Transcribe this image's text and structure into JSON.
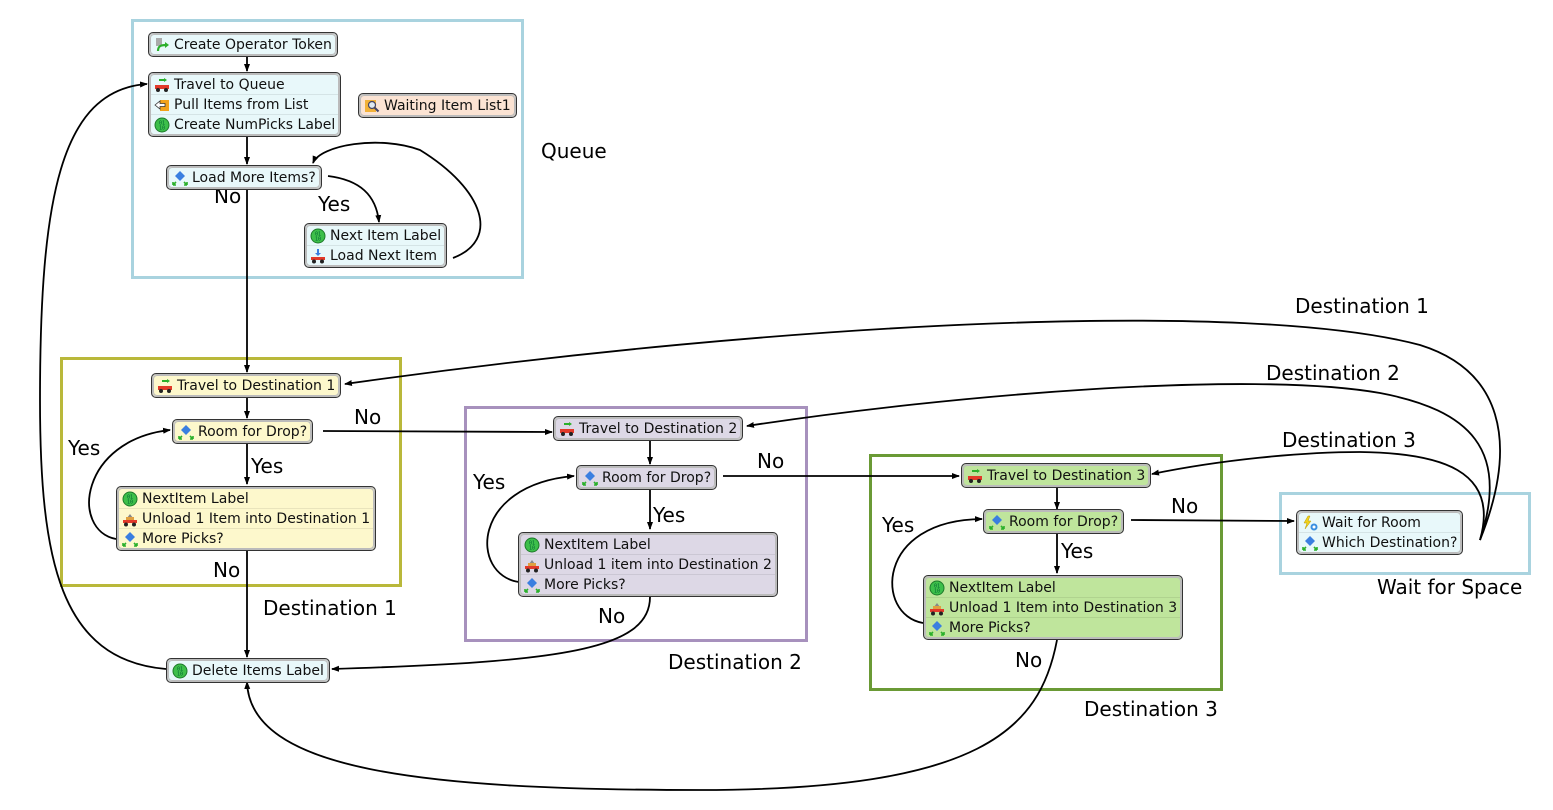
{
  "colors": {
    "queue_border": "#a9d3df",
    "dest1_border": "#b9b83a",
    "dest2_border": "#a791bd",
    "dest3_border": "#6a9a35",
    "wait_border": "#a9d3df",
    "node_blue": "#e8f8fa",
    "node_yellow": "#fdf8cc",
    "node_purple": "#ddd8e6",
    "node_green": "#bfe59c",
    "node_orange": "#fbe3d3"
  },
  "groups": {
    "queue": {
      "label": "Queue"
    },
    "dest1": {
      "label": "Destination 1"
    },
    "dest2": {
      "label": "Destination 2"
    },
    "dest3": {
      "label": "Destination 3"
    },
    "wait": {
      "label": "Wait for Space"
    }
  },
  "nodes": {
    "create_token": {
      "rows": [
        {
          "icon": "create-token-icon",
          "label": "Create Operator Token"
        }
      ]
    },
    "travel_queue": {
      "rows": [
        {
          "icon": "travel-icon",
          "label": "Travel to Queue"
        },
        {
          "icon": "pull-list-icon",
          "label": "Pull Items from List"
        },
        {
          "icon": "label-icon",
          "label": "Create NumPicks Label"
        }
      ]
    },
    "waiting_list": {
      "rows": [
        {
          "icon": "list-search-icon",
          "label": "Waiting Item List1"
        }
      ]
    },
    "load_more": {
      "rows": [
        {
          "icon": "decide-icon",
          "label": "Load More Items?"
        }
      ]
    },
    "next_item": {
      "rows": [
        {
          "icon": "label-icon",
          "label": "Next Item Label"
        },
        {
          "icon": "load-icon",
          "label": "Load Next Item"
        }
      ]
    },
    "travel_d1": {
      "rows": [
        {
          "icon": "travel-icon",
          "label": "Travel to Destination 1"
        }
      ]
    },
    "room_d1": {
      "rows": [
        {
          "icon": "decide-icon",
          "label": "Room for Drop?"
        }
      ]
    },
    "unload_d1": {
      "rows": [
        {
          "icon": "label-icon",
          "label": "NextItem Label"
        },
        {
          "icon": "unload-icon",
          "label": "Unload 1 Item into Destination 1"
        },
        {
          "icon": "decide-icon",
          "label": "More Picks?"
        }
      ]
    },
    "travel_d2": {
      "rows": [
        {
          "icon": "travel-icon",
          "label": "Travel to Destination 2"
        }
      ]
    },
    "room_d2": {
      "rows": [
        {
          "icon": "decide-icon",
          "label": "Room for Drop?"
        }
      ]
    },
    "unload_d2": {
      "rows": [
        {
          "icon": "label-icon",
          "label": "NextItem Label"
        },
        {
          "icon": "unload-icon",
          "label": "Unload 1 item into Destination 2"
        },
        {
          "icon": "decide-icon",
          "label": "More Picks?"
        }
      ]
    },
    "travel_d3": {
      "rows": [
        {
          "icon": "travel-icon",
          "label": "Travel to Destination 3"
        }
      ]
    },
    "room_d3": {
      "rows": [
        {
          "icon": "decide-icon",
          "label": "Room for Drop?"
        }
      ]
    },
    "unload_d3": {
      "rows": [
        {
          "icon": "label-icon",
          "label": "NextItem Label"
        },
        {
          "icon": "unload-icon",
          "label": "Unload 1 Item into Destination 3"
        },
        {
          "icon": "decide-icon",
          "label": "More Picks?"
        }
      ]
    },
    "wait_room": {
      "rows": [
        {
          "icon": "wait-event-icon",
          "label": "Wait for Room"
        },
        {
          "icon": "decide-icon",
          "label": "Which Destination?"
        }
      ]
    },
    "delete_label": {
      "rows": [
        {
          "icon": "label-icon",
          "label": "Delete Items Label"
        }
      ]
    }
  },
  "edge_labels": {
    "load_no": "No",
    "load_yes": "Yes",
    "d1_no": "No",
    "d1_yes_down": "Yes",
    "d1_yes_loop": "Yes",
    "d1_more_no": "No",
    "d2_no": "No",
    "d2_yes_down": "Yes",
    "d2_yes_loop": "Yes",
    "d2_more_no": "No",
    "d3_no": "No",
    "d3_yes_down": "Yes",
    "d3_yes_loop": "Yes",
    "d3_more_no": "No",
    "wait_dest1": "Destination 1",
    "wait_dest2": "Destination 2",
    "wait_dest3": "Destination 3"
  }
}
